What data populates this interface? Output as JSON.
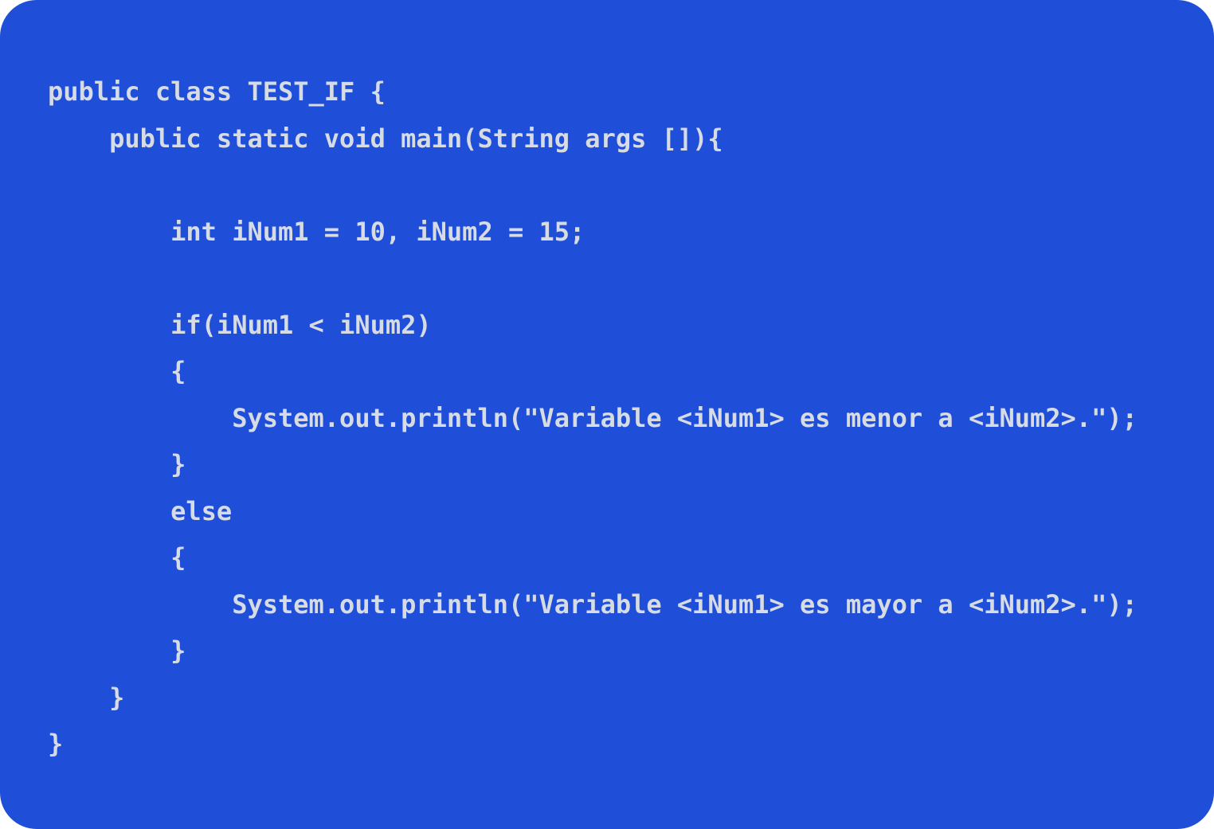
{
  "colors": {
    "background": "#1f4ed8",
    "text": "#d6dbe4"
  },
  "code": {
    "lines": [
      "public class TEST_IF {",
      "    public static void main(String args []){",
      "",
      "        int iNum1 = 10, iNum2 = 15;",
      "",
      "        if(iNum1 < iNum2)",
      "        {",
      "            System.out.println(\"Variable <iNum1> es menor a <iNum2>.\");",
      "        }",
      "        else",
      "        {",
      "            System.out.println(\"Variable <iNum1> es mayor a <iNum2>.\");",
      "        }",
      "    }",
      "}"
    ]
  }
}
